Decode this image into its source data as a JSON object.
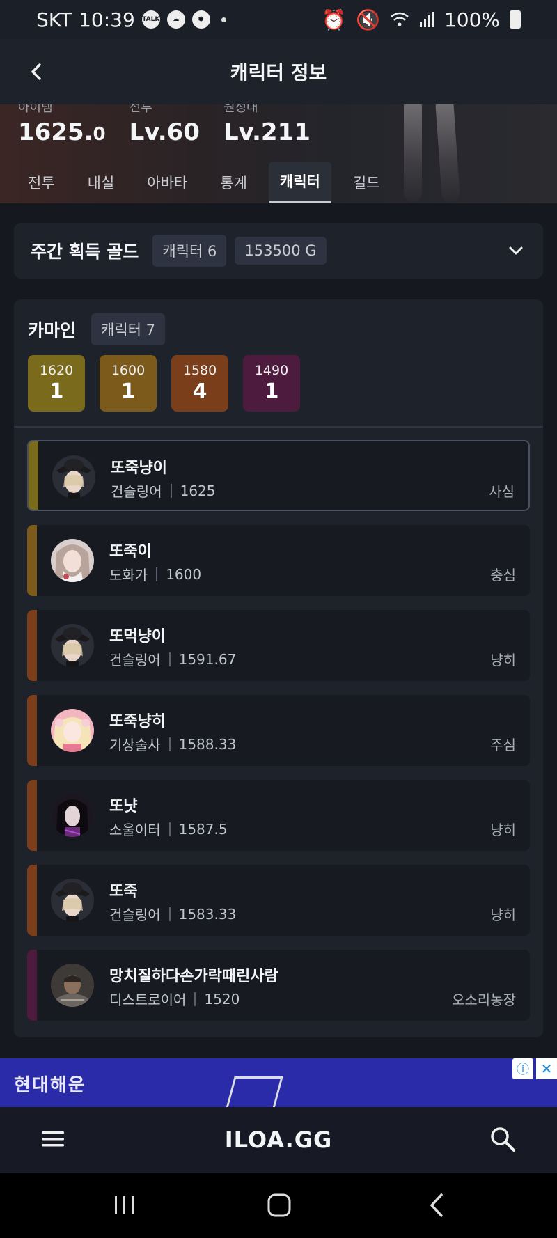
{
  "status_bar": {
    "carrier": "SKT",
    "time": "10:39",
    "talk_badge": "TALK",
    "battery": "100%",
    "icons": [
      "talk-icon",
      "cloud-icon",
      "box-icon",
      "alarm-icon",
      "mute-icon",
      "wifi-icon",
      "signal-icon",
      "battery-icon"
    ]
  },
  "header": {
    "title": "캐릭터 정보",
    "back_icon": "chevron-left-icon"
  },
  "hero": {
    "stats": [
      {
        "label": "아이템",
        "value": "1625.",
        "decimal": "0"
      },
      {
        "label": "전투",
        "value": "Lv.60",
        "decimal": ""
      },
      {
        "label": "원정대",
        "value": "Lv.211",
        "decimal": ""
      }
    ],
    "tabs": [
      "전투",
      "내실",
      "아바타",
      "통계",
      "캐릭터",
      "길드"
    ],
    "active_tab": "캐릭터"
  },
  "weekly_gold": {
    "title": "주간 획득 골드",
    "character_chip": "캐릭터 6",
    "gold_chip": "153500 G"
  },
  "server": {
    "name": "카마인",
    "character_chip": "캐릭터 7",
    "level_groups": [
      {
        "level": "1620",
        "count": "1",
        "color": "#7a6a1c"
      },
      {
        "level": "1600",
        "count": "1",
        "color": "#7c5a1b"
      },
      {
        "level": "1580",
        "count": "4",
        "color": "#7a3f1a"
      },
      {
        "level": "1490",
        "count": "1",
        "color": "#4d1b3d"
      }
    ],
    "characters": [
      {
        "name": "또죽냥이",
        "class": "건슬링어",
        "level": "1625",
        "guild": "사심",
        "bar_color": "#7a6a1c",
        "avatar": "gunslinger",
        "selected": true
      },
      {
        "name": "또죽이",
        "class": "도화가",
        "level": "1600",
        "guild": "충심",
        "bar_color": "#7c5a1b",
        "avatar": "artist",
        "selected": false
      },
      {
        "name": "또먹냥이",
        "class": "건슬링어",
        "level": "1591.67",
        "guild": "냥히",
        "bar_color": "#7a3f1a",
        "avatar": "gunslinger",
        "selected": false
      },
      {
        "name": "또죽냥히",
        "class": "기상술사",
        "level": "1588.33",
        "guild": "주심",
        "bar_color": "#7a3f1a",
        "avatar": "aeromancer",
        "selected": false
      },
      {
        "name": "또냣",
        "class": "소울이터",
        "level": "1587.5",
        "guild": "냥히",
        "bar_color": "#7a3f1a",
        "avatar": "souleater",
        "selected": false
      },
      {
        "name": "또죽",
        "class": "건슬링어",
        "level": "1583.33",
        "guild": "냥히",
        "bar_color": "#7a3f1a",
        "avatar": "gunslinger",
        "selected": false
      },
      {
        "name": "망치질하다손가락때린사람",
        "class": "디스트로이어",
        "level": "1520",
        "guild": "오소리농장",
        "bar_color": "#4d1b3d",
        "avatar": "destroyer",
        "selected": false
      }
    ]
  },
  "ad": {
    "brand": "현대해운",
    "info_icon": "ad-info-icon",
    "close_icon": "close-icon"
  },
  "bottom_bar": {
    "logo": "ILOA.GG",
    "menu_icon": "hamburger-menu-icon",
    "search_icon": "search-icon"
  },
  "system_nav": {
    "icons": [
      "recent-apps-icon",
      "home-icon",
      "back-icon"
    ]
  }
}
